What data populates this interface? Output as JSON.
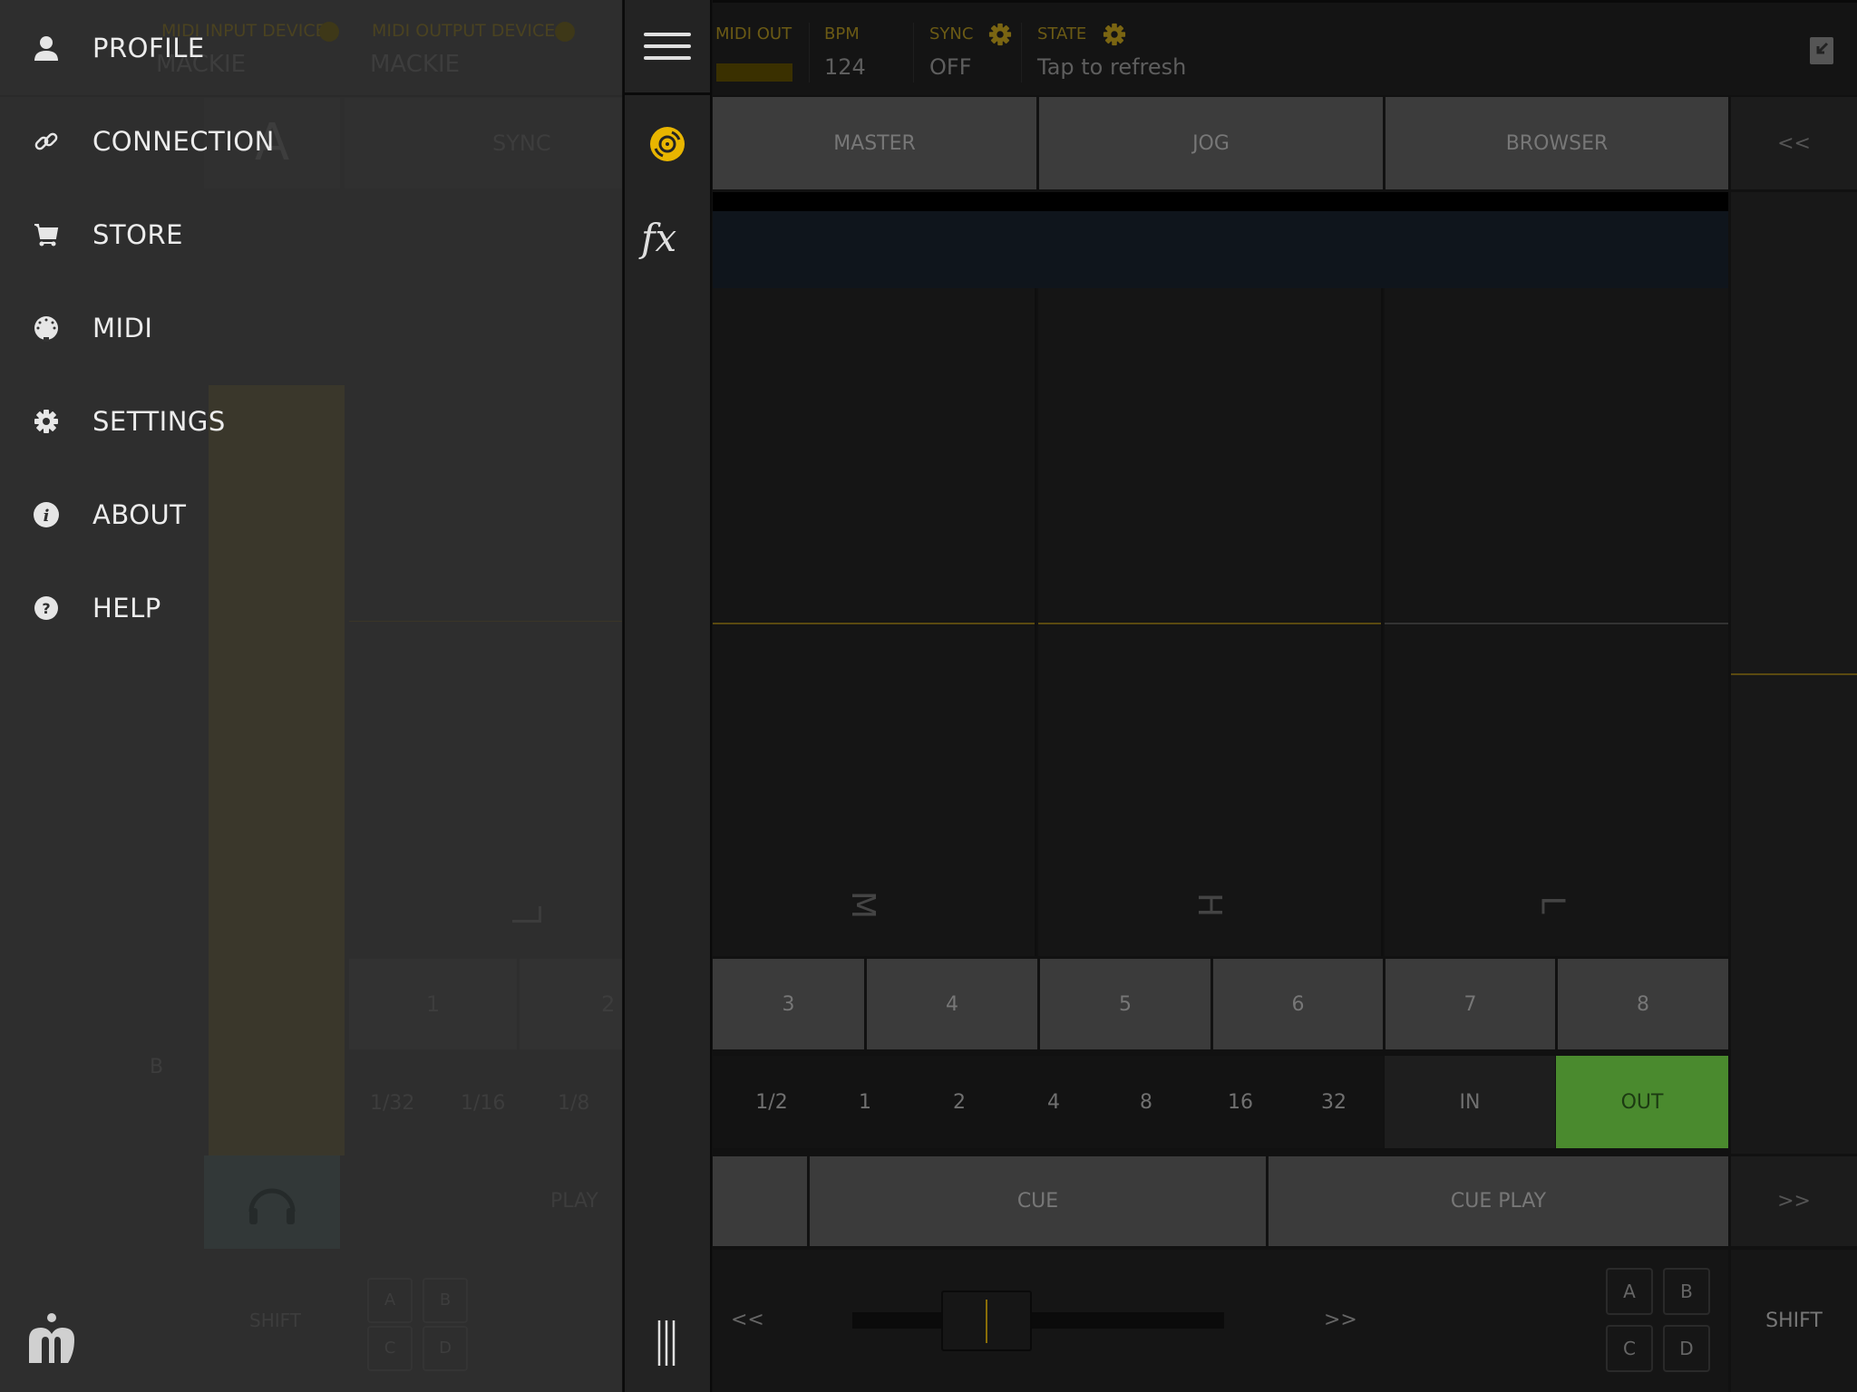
{
  "background_deck": {
    "midi_input_label": "MIDI INPUT DEVICE",
    "midi_input_value": "MACKIE",
    "midi_output_label": "MIDI OUTPUT DEVICE",
    "midi_output_value": "MACKIE",
    "deck_letter": "A",
    "sync_label": "SYNC",
    "side_letter": "B",
    "pads": [
      "1",
      "2"
    ],
    "loop_sizes": [
      "1/32",
      "1/16",
      "1/8"
    ],
    "play_label": "PLAY",
    "shift_label": "SHIFT",
    "abcd": [
      "A",
      "B",
      "C",
      "D"
    ]
  },
  "drawer": {
    "items": [
      {
        "label": "PROFILE",
        "icon": "person-icon"
      },
      {
        "label": "CONNECTION",
        "icon": "link-icon"
      },
      {
        "label": "STORE",
        "icon": "cart-icon"
      },
      {
        "label": "MIDI",
        "icon": "midi-connector-icon"
      },
      {
        "label": "SETTINGS",
        "icon": "gear-icon"
      },
      {
        "label": "ABOUT",
        "icon": "info-icon"
      },
      {
        "label": "HELP",
        "icon": "help-icon"
      }
    ],
    "logo": "app-logo"
  },
  "rail": {
    "items": [
      "menu-icon",
      "deck-icon",
      "fx-icon",
      "mixer-icon"
    ],
    "fx_label": "fx"
  },
  "topbar": {
    "midi_out_label": "MIDI OUT",
    "bpm_label": "BPM",
    "bpm_value": "124",
    "sync_label": "SYNC",
    "sync_value": "OFF",
    "state_label": "STATE",
    "state_value": "Tap to refresh"
  },
  "tabs": [
    "MASTER",
    "JOG",
    "BROWSER"
  ],
  "nav": {
    "prev": "<<",
    "next": ">>"
  },
  "eq": {
    "bands": [
      "M",
      "H",
      "L"
    ],
    "levels": [
      0.5,
      0.5,
      0.5
    ],
    "right_level": 0.5
  },
  "pads": [
    "3",
    "4",
    "5",
    "6",
    "7",
    "8"
  ],
  "loop": {
    "sizes": [
      "1/2",
      "1",
      "2",
      "4",
      "8",
      "16",
      "32"
    ],
    "in_label": "IN",
    "out_label": "OUT",
    "active_color": "#4a8a2e"
  },
  "cue": {
    "cue_label": "CUE",
    "cue_play_label": "CUE PLAY"
  },
  "bottom": {
    "pitch_prev": "<<",
    "pitch_next": ">>",
    "crossfader_position": 0.5,
    "abcd": [
      "A",
      "B",
      "C",
      "D"
    ],
    "shift_label": "SHIFT"
  },
  "colors": {
    "accent": "#e8b500",
    "loop_active": "#4a8a2e"
  }
}
